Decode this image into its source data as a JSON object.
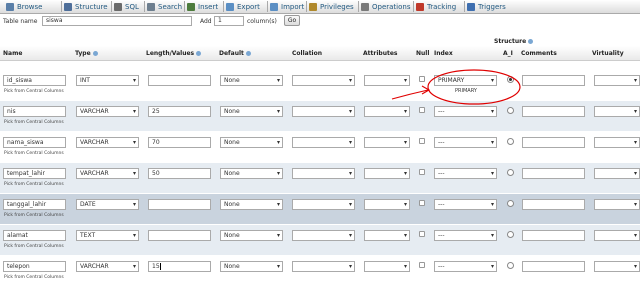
{
  "tabs": [
    {
      "label": "Browse",
      "icon": "browse-icon",
      "color": "#5a7fa8"
    },
    {
      "label": "Structure",
      "icon": "structure-icon",
      "color": "#4f6f9a"
    },
    {
      "label": "SQL",
      "icon": "sql-icon",
      "color": "#6b6b6b"
    },
    {
      "label": "Search",
      "icon": "search-icon",
      "color": "#6e7f8f"
    },
    {
      "label": "Insert",
      "icon": "insert-icon",
      "color": "#4d7c3d"
    },
    {
      "label": "Export",
      "icon": "export-icon",
      "color": "#5b8fc4"
    },
    {
      "label": "Import",
      "icon": "import-icon",
      "color": "#5b8fc4"
    },
    {
      "label": "Privileges",
      "icon": "privileges-icon",
      "color": "#b0892c"
    },
    {
      "label": "Operations",
      "icon": "operations-icon",
      "color": "#7a7a7a"
    },
    {
      "label": "Tracking",
      "icon": "tracking-icon",
      "color": "#c0392b"
    },
    {
      "label": "Triggers",
      "icon": "triggers-icon",
      "color": "#3f6fb0"
    }
  ],
  "table_name_label": "Table name",
  "table_name_value": "siswa",
  "add_label": "Add",
  "add_value": "1",
  "columns_label": "column(s)",
  "go_label": "Go",
  "structure_label": "Structure",
  "headers": {
    "name": "Name",
    "type": "Type",
    "length": "Length/Values",
    "default": "Default",
    "collation": "Collation",
    "attributes": "Attributes",
    "null": "Null",
    "index": "Index",
    "ai": "A_I",
    "comments": "Comments",
    "virtuality": "Virtuality"
  },
  "pick_label": "Pick from Central Columns",
  "primary_sub": "PRIMARY",
  "rows": [
    {
      "name": "id_siswa",
      "type": "INT",
      "length": "",
      "default": "None",
      "index": "PRIMARY",
      "ai": true
    },
    {
      "name": "nis",
      "type": "VARCHAR",
      "length": "25",
      "default": "None",
      "index": "---",
      "ai": false
    },
    {
      "name": "nama_siswa",
      "type": "VARCHAR",
      "length": "70",
      "default": "None",
      "index": "---",
      "ai": false
    },
    {
      "name": "tempat_lahir",
      "type": "VARCHAR",
      "length": "50",
      "default": "None",
      "index": "---",
      "ai": false
    },
    {
      "name": "tanggal_lahir",
      "type": "DATE",
      "length": "",
      "default": "None",
      "index": "---",
      "ai": false
    },
    {
      "name": "alamat",
      "type": "TEXT",
      "length": "",
      "default": "None",
      "index": "---",
      "ai": false
    },
    {
      "name": "telepon",
      "type": "VARCHAR",
      "length": "15",
      "default": "None",
      "index": "---",
      "ai": false
    }
  ]
}
